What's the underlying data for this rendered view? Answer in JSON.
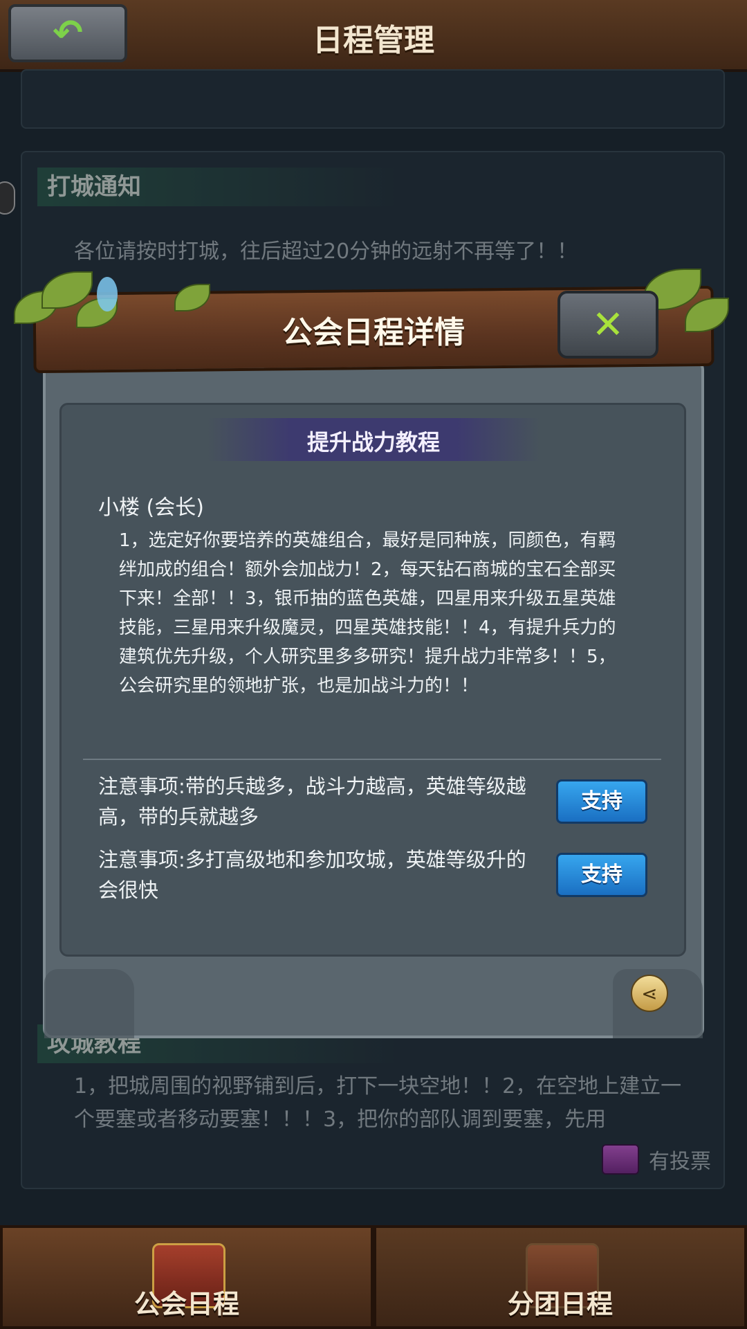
{
  "header": {
    "title": "日程管理",
    "back_icon": "back-arrow-icon"
  },
  "background_panels": [
    {
      "title": "打城通知",
      "text": "各位请按时打城，往后超过20分钟的远射不再等了！！"
    },
    {
      "title": "攻城教程",
      "text": "1，把城周围的视野铺到后，打下一块空地！！2，在空地上建立一个要塞或者移动要塞！！！3，把你的部队调到要塞，先用"
    }
  ],
  "vote": {
    "label": "有投票",
    "icon": "ballot-box-icon"
  },
  "bottom_nav": [
    {
      "label": "公会日程",
      "active": true
    },
    {
      "label": "分团日程",
      "active": false
    }
  ],
  "modal": {
    "title": "公会日程详情",
    "close_icon": "close-x-icon",
    "subtitle": "提升战力教程",
    "author": "小楼 (会长)",
    "content": "1，选定好你要培养的英雄组合，最好是同种族，同颜色，有羁绊加成的组合！额外会加战力！2，每天钻石商城的宝石全部买下来！全部！！3，银币抽的蓝色英雄，四星用来升级五星英雄技能，三星用来升级魔灵，四星英雄技能！！4，有提升兵力的建筑优先升级，个人研究里多多研究！提升战力非常多！！5，公会研究里的领地扩张，也是加战斗力的！！",
    "notes": [
      {
        "text": "注意事项:带的兵越多，战斗力越高，英雄等级越高，带的兵就越多",
        "button": "支持"
      },
      {
        "text": "注意事项:多打高级地和参加攻城，英雄等级升的会很快",
        "button": "支持"
      }
    ],
    "share_icon": "share-icon"
  }
}
